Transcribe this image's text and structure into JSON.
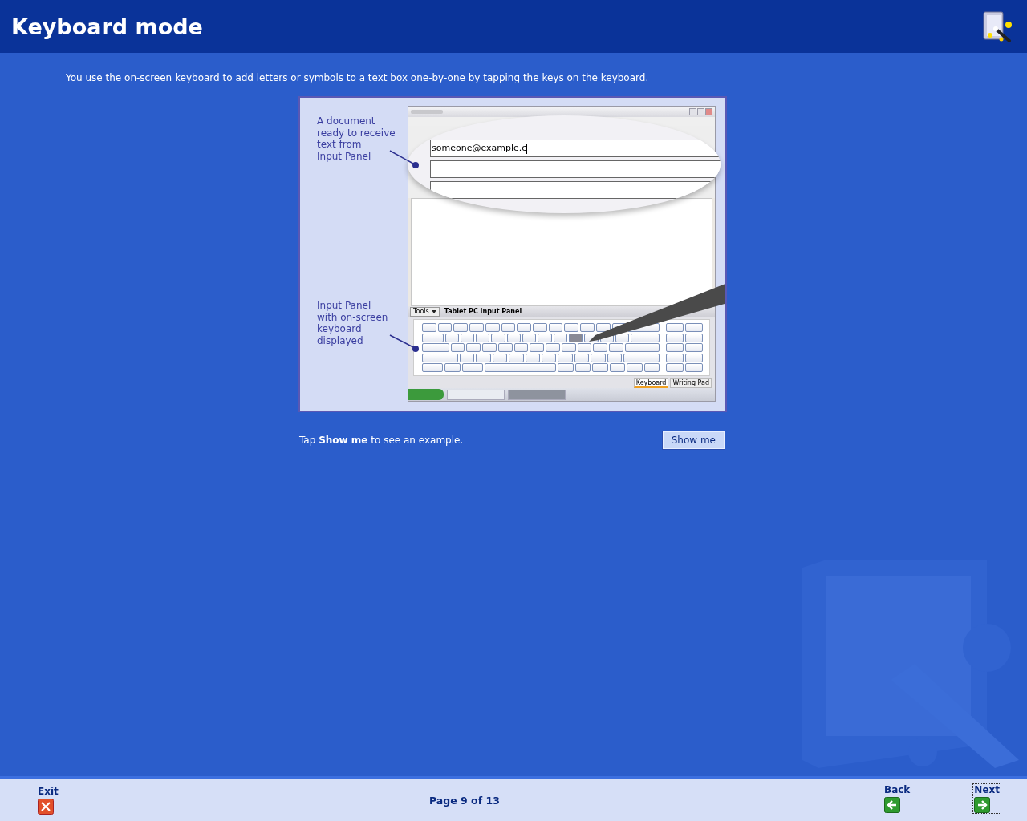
{
  "header": {
    "title": "Keyboard mode"
  },
  "intro": "You use the on-screen keyboard to add letters or symbols to a text box one-by-one by tapping the keys on the keyboard.",
  "illustration": {
    "callouts": [
      {
        "lines": [
          "A document",
          "ready to receive",
          "text from",
          "Input Panel"
        ]
      },
      {
        "lines": [
          "Input Panel",
          "with on-screen",
          "keyboard",
          "displayed"
        ]
      }
    ],
    "document": {
      "field_value": "someone@example.c"
    },
    "input_panel": {
      "tools_label": "Tools",
      "title": "Tablet PC Input Panel",
      "tabs": [
        {
          "label": "Keyboard",
          "selected": true
        },
        {
          "label": "Writing Pad",
          "selected": false
        }
      ]
    }
  },
  "prompt": "Tap **Show me** to see an example.",
  "show_me_button": "Show me",
  "footer": {
    "exit": {
      "label": "Exit"
    },
    "page": "Page 9 of 13",
    "back": {
      "label": "Back",
      "focused": false
    },
    "next": {
      "label": "Next",
      "focused": true
    }
  }
}
